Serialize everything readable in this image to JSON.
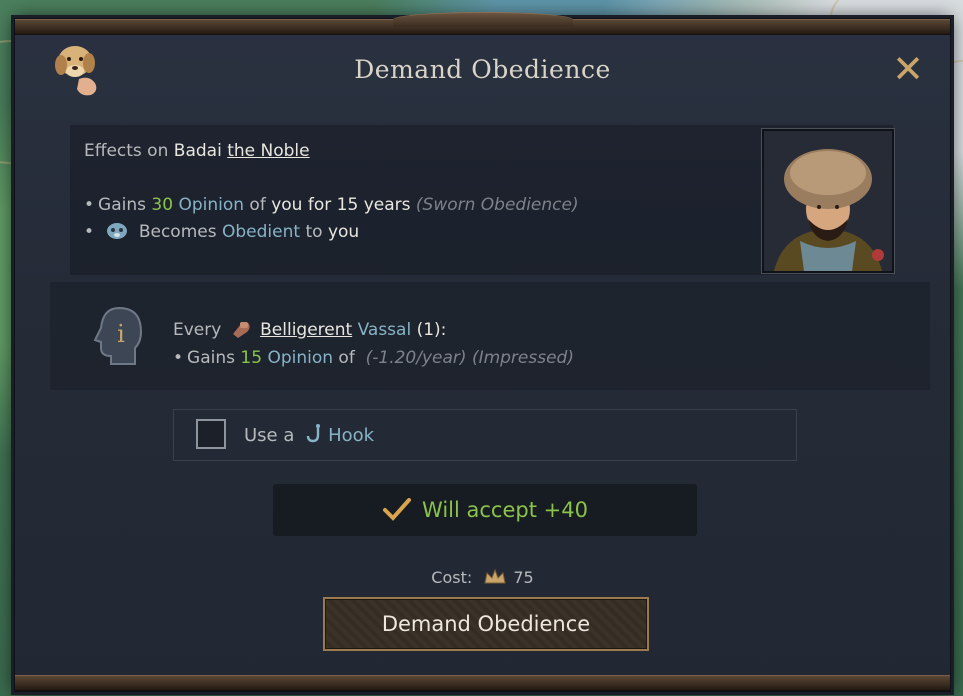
{
  "window": {
    "title": "Demand Obedience",
    "close_icon": "close-icon"
  },
  "effects": {
    "prefix": "Effects on",
    "target_name": "Badai",
    "target_title": "the Noble",
    "line1": {
      "prefix": "Gains",
      "value": "30",
      "word": "Opinion",
      "mid": "of",
      "who": "you",
      "dur": "for 15 years",
      "reason": "(Sworn Obedience)"
    },
    "line2": {
      "prefix": "Becomes",
      "status": "Obedient",
      "mid": "to",
      "who": "you"
    }
  },
  "info": {
    "line1": {
      "prefix": "Every",
      "trait": "Belligerent",
      "role": "Vassal",
      "count": "(1):"
    },
    "line2": {
      "prefix": "Gains",
      "value": "15",
      "word": "Opinion",
      "mid": "of",
      "rate": "(-1.20/year)",
      "reason": "(Impressed)"
    }
  },
  "hook": {
    "label_prefix": "Use a",
    "label": "Hook",
    "checked": false
  },
  "acceptance": {
    "text": "Will accept +40"
  },
  "cost": {
    "label": "Cost:",
    "value": "75"
  },
  "action_button": {
    "label": "Demand Obedience"
  },
  "colors": {
    "positive": "#8bc34a",
    "keyword": "#86b3c6",
    "frame_gold": "#9a7a4e"
  }
}
